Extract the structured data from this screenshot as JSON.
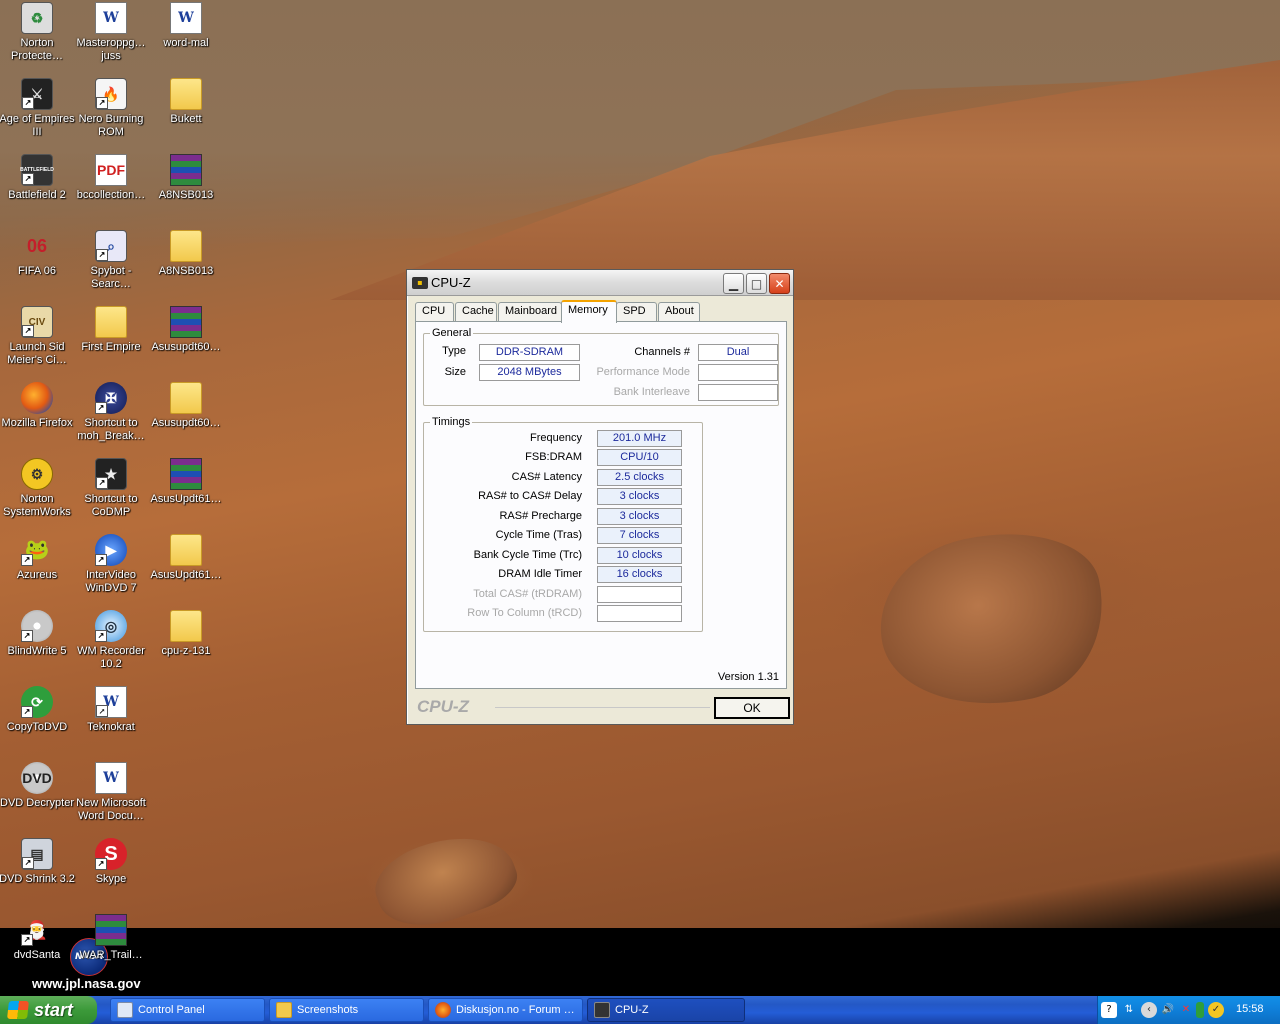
{
  "desktop": {
    "icons": [
      {
        "label": "Norton Protecte…"
      },
      {
        "label": "Masteroppg… juss"
      },
      {
        "label": "word-mal"
      },
      {
        "label": "Age of Empires III"
      },
      {
        "label": "Nero Burning ROM"
      },
      {
        "label": "Bukett"
      },
      {
        "label": "Battlefield 2"
      },
      {
        "label": "bccollection…"
      },
      {
        "label": "A8NSB013"
      },
      {
        "label": "FIFA 06"
      },
      {
        "label": "Spybot - Searc…"
      },
      {
        "label": "A8NSB013"
      },
      {
        "label": "Launch Sid Meier's Ci…"
      },
      {
        "label": "First Empire"
      },
      {
        "label": "Asusupdt60…"
      },
      {
        "label": "Mozilla Firefox"
      },
      {
        "label": "Shortcut to moh_Break…"
      },
      {
        "label": "Asusupdt60…"
      },
      {
        "label": "Norton SystemWorks"
      },
      {
        "label": "Shortcut to CoDMP"
      },
      {
        "label": "AsusUpdt61…"
      },
      {
        "label": "Azureus"
      },
      {
        "label": "InterVideo WinDVD 7"
      },
      {
        "label": "AsusUpdt61…"
      },
      {
        "label": "BlindWrite 5"
      },
      {
        "label": "WM Recorder 10.2"
      },
      {
        "label": "cpu-z-131"
      },
      {
        "label": "CopyToDVD"
      },
      {
        "label": "Teknokrat"
      },
      {
        "label": "DVD Decrypter"
      },
      {
        "label": "New Microsoft Word Docu…"
      },
      {
        "label": "DVD Shrink 3.2"
      },
      {
        "label": "Skype"
      },
      {
        "label": "dvdSanta"
      },
      {
        "label": "WAR_Trail…"
      }
    ],
    "icon_glyphs": {
      "fifa": "06",
      "civ": "CIV",
      "bf2": "BATTLEFIELD",
      "pdf": "PDF",
      "dvd": "DVD",
      "skype": "S",
      "word": "W",
      "jpl_logo": "NASA"
    },
    "wallpaper_credit": "www.jpl.nasa.gov"
  },
  "cpuz": {
    "title": "CPU-Z",
    "tabs": [
      {
        "label": "CPU"
      },
      {
        "label": "Cache"
      },
      {
        "label": "Mainboard"
      },
      {
        "label": "Memory",
        "active": true
      },
      {
        "label": "SPD"
      },
      {
        "label": "About"
      }
    ],
    "general": {
      "title": "General",
      "type_label": "Type",
      "type_value": "DDR-SDRAM",
      "size_label": "Size",
      "size_value": "2048 MBytes",
      "channels_label": "Channels #",
      "channels_value": "Dual",
      "perf_mode_label": "Performance Mode",
      "perf_mode_value": "",
      "bank_interleave_label": "Bank Interleave",
      "bank_interleave_value": ""
    },
    "timings": {
      "title": "Timings",
      "rows": [
        {
          "label": "Frequency",
          "value": "201.0 MHz",
          "disabled": false
        },
        {
          "label": "FSB:DRAM",
          "value": "CPU/10",
          "disabled": false
        },
        {
          "label": "CAS# Latency",
          "value": "2.5 clocks",
          "disabled": false
        },
        {
          "label": "RAS# to CAS# Delay",
          "value": "3 clocks",
          "disabled": false
        },
        {
          "label": "RAS# Precharge",
          "value": "3 clocks",
          "disabled": false
        },
        {
          "label": "Cycle Time (Tras)",
          "value": "7 clocks",
          "disabled": false
        },
        {
          "label": "Bank Cycle Time (Trc)",
          "value": "10 clocks",
          "disabled": false
        },
        {
          "label": "DRAM Idle Timer",
          "value": "16 clocks",
          "disabled": false
        },
        {
          "label": "Total CAS# (tRDRAM)",
          "value": "",
          "disabled": true
        },
        {
          "label": "Row To Column (tRCD)",
          "value": "",
          "disabled": true
        }
      ]
    },
    "version": "Version 1.31",
    "brand": "CPU-Z",
    "ok_label": "OK"
  },
  "taskbar": {
    "start_label": "start",
    "buttons": [
      {
        "label": "Control Panel",
        "active": false
      },
      {
        "label": "Screenshots",
        "active": false
      },
      {
        "label": "Diskusjon.no - Forum …",
        "active": false
      },
      {
        "label": "CPU-Z",
        "active": true
      }
    ],
    "clock": "15:58"
  },
  "colors": {
    "xp_blue": "#245dd7",
    "start_green": "#3c9a3a",
    "value_text": "#1c2a9c"
  }
}
